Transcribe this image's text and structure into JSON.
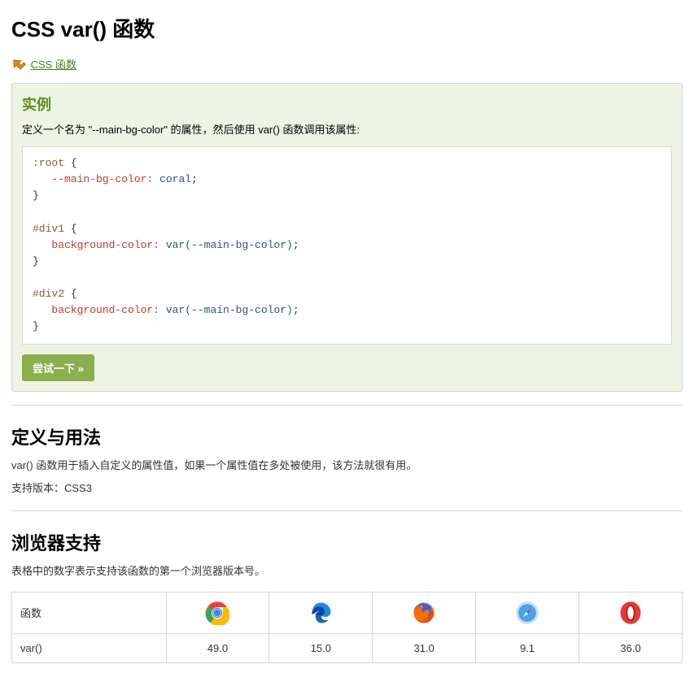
{
  "title": "CSS var() 函数",
  "navup_label": " CSS 函数",
  "example": {
    "title": "实例",
    "desc": "定义一个名为 \"--main-bg-color\" 的属性，然后使用 var() 函数调用该属性:",
    "code": {
      "sel1": ":root",
      "attr1": "--main-bg-color:",
      "val1": " coral",
      "sel2": "#div1",
      "attr2": "background-color:",
      "val2": " var(--main-bg-color)",
      "sel3": "#div2",
      "attr3": "background-color:",
      "val3": " var(--main-bg-color)"
    },
    "try_label": "尝试一下 »"
  },
  "definition": {
    "heading": "定义与用法",
    "p1": "var() 函数用于插入自定义的属性值，如果一个属性值在多处被使用，该方法就很有用。",
    "p2": "支持版本：CSS3"
  },
  "support": {
    "heading": "浏览器支持",
    "note": "表格中的数字表示支持该函数的第一个浏览器版本号。",
    "row_header": "函数",
    "func_name": "var()",
    "chrome": "49.0",
    "edge": "15.0",
    "firefox": "31.0",
    "safari": "9.1",
    "opera": "36.0"
  }
}
